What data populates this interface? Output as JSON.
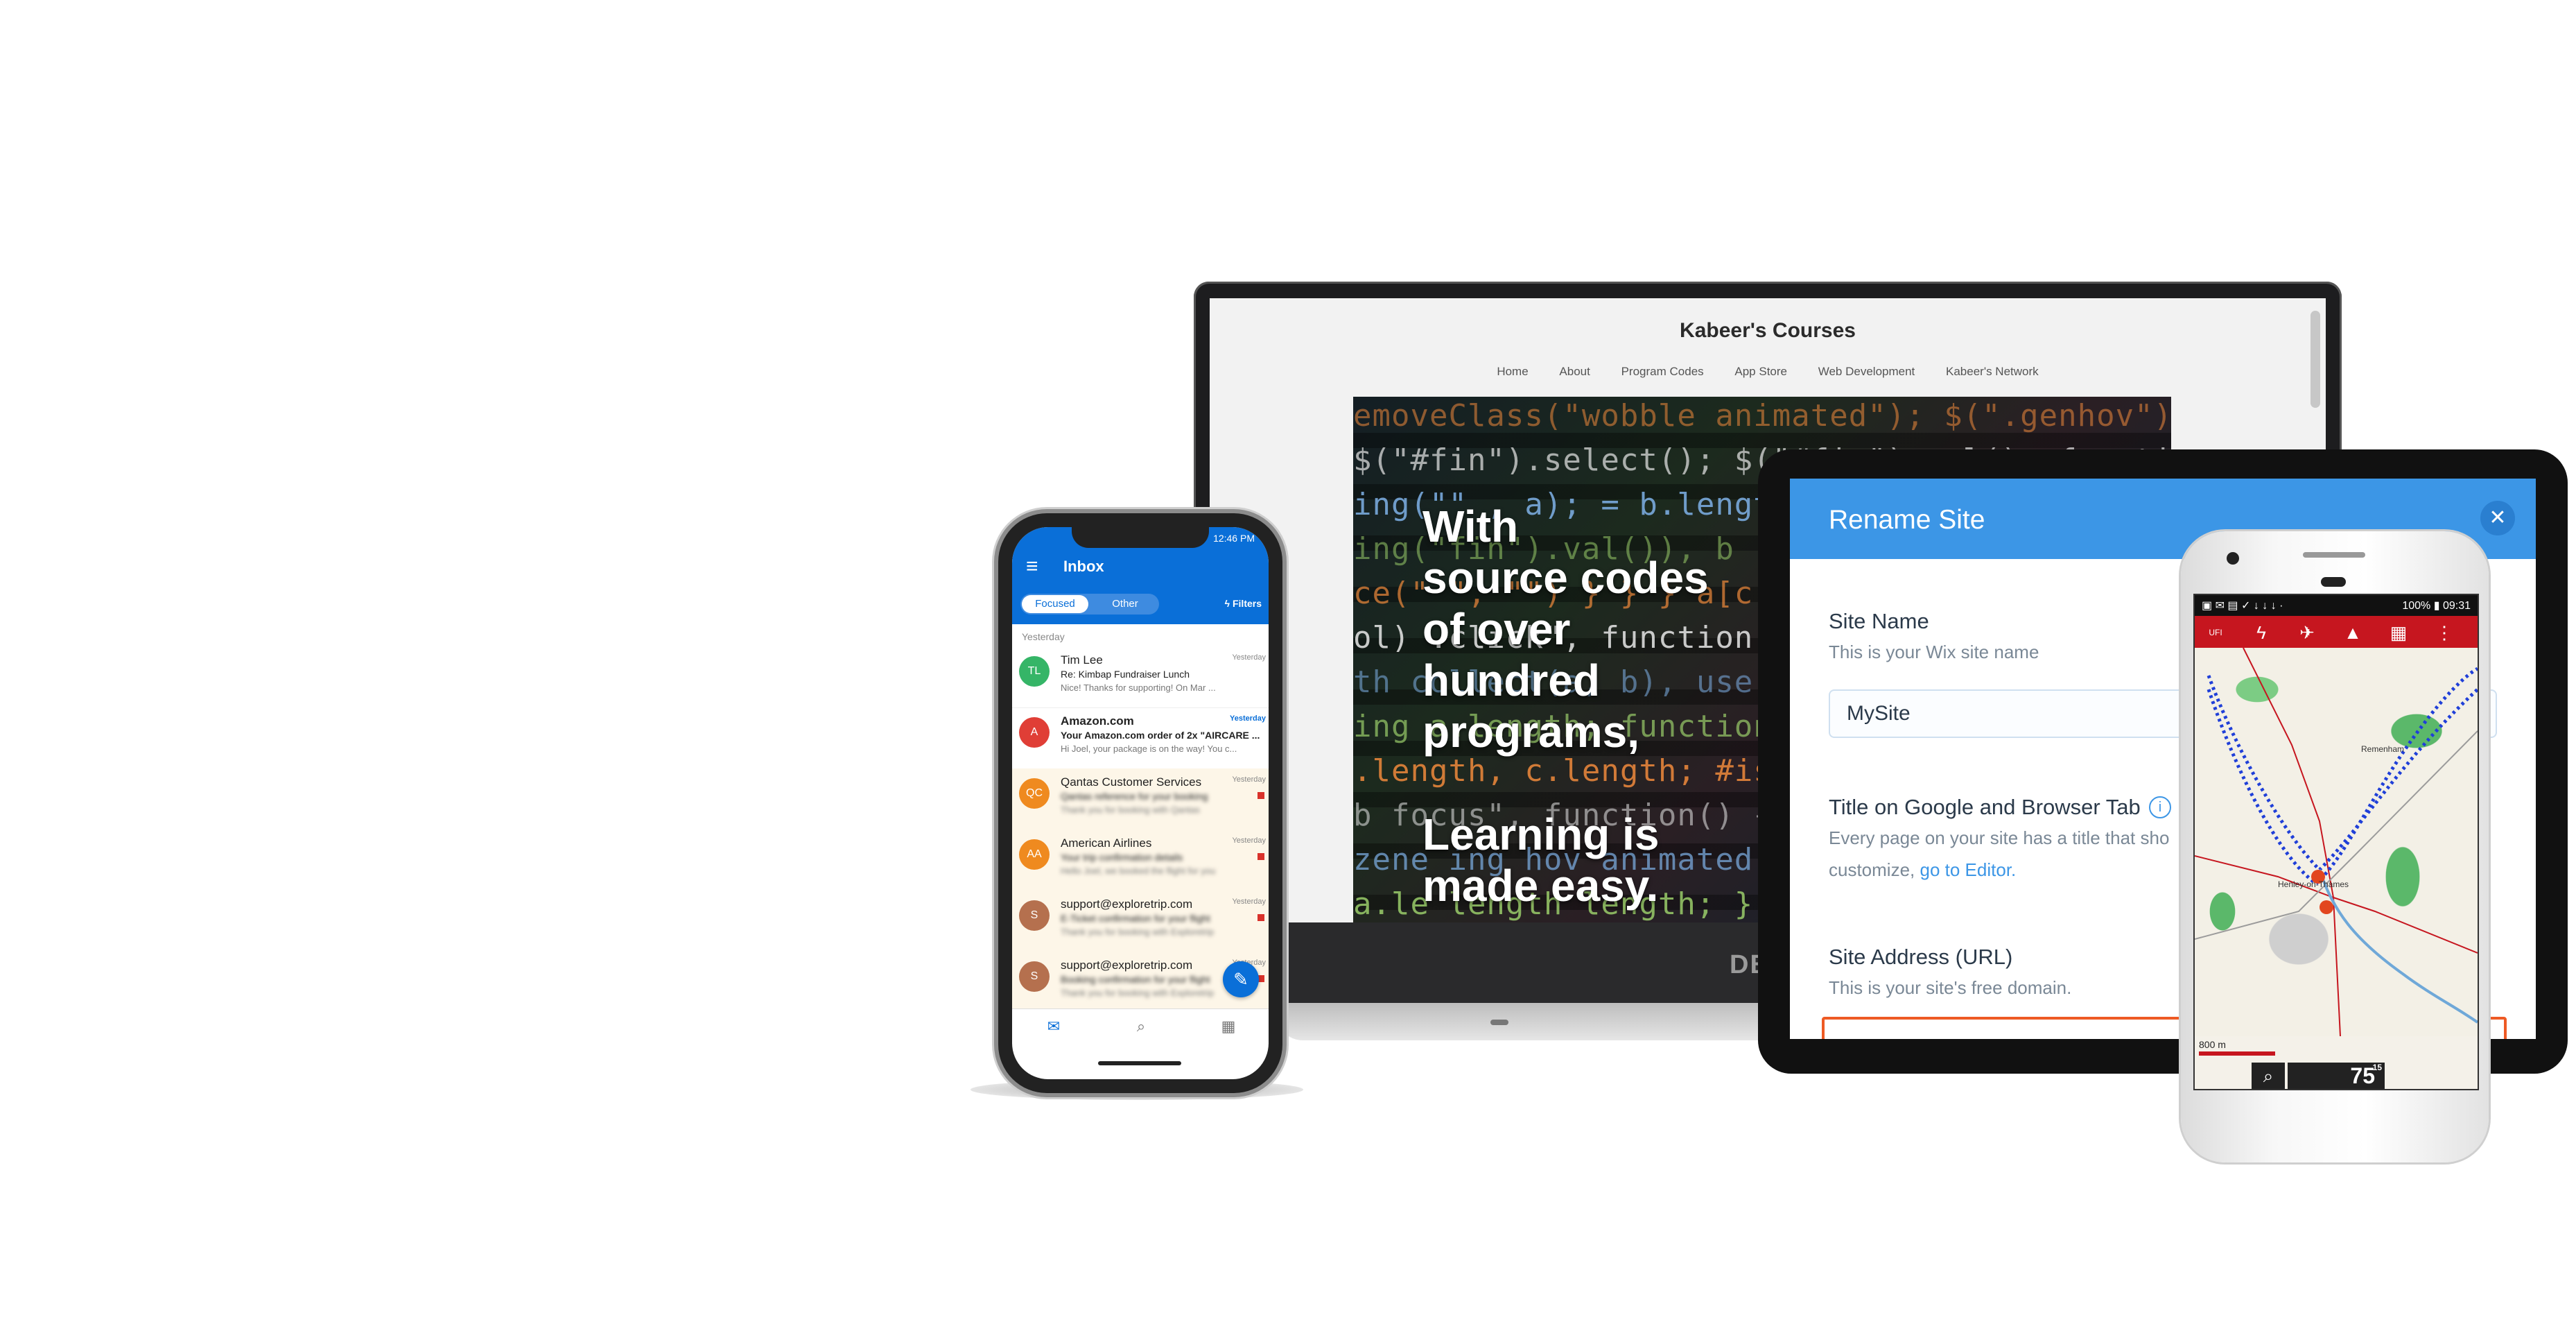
{
  "laptop": {
    "site_title": "Kabeer's Courses",
    "nav": [
      "Home",
      "About",
      "Program Codes",
      "App Store",
      "Web Development",
      "Kabeer's Network"
    ],
    "hero_lines": [
      "With",
      "source codes",
      "of over",
      "hundred",
      "programs,",
      "",
      "Learning is",
      "made easy."
    ],
    "code_lines": [
      "emoveClass(\"wobble animated\");  $(\".genhov\").removeClass",
      "$(\"#fin\").select();      $(\"#fin\").val(); function era",
      "ing(\"\"  , a);      = b.length; d = a.length",
      "ing(\"fin\").val()), b      ; c++) { if (a[c] ==",
      "ce(\"  \", \"\")        }  }  }  a[c] = a[c]",
      "ol)     .click\", function(a, b) {",
      "th  collect(a, b), use",
      "ing   a.length;  function(a,",
      "  .length, c.length;  #isp-st",
      "  b  focus\", function() {",
      "zene  ing  hov  animated\");",
      "a.le  length  length; }"
    ],
    "logo": "DELL",
    "colors": {
      "code_orange": "#f08a3c",
      "code_white": "#e8e8e8",
      "code_blue": "#7fb2e8",
      "code_green": "#9acd6a"
    }
  },
  "tablet": {
    "dialog_title": "Rename Site",
    "close_icon": "close-icon",
    "site_name_label": "Site Name",
    "site_name_help": "This is your Wix site name",
    "site_name_value": "MySite",
    "title_label": "Title on Google and Browser Tab",
    "title_help_1": "Every page on your site has a title that sho",
    "title_help_2_prefix": "customize,",
    "title_help_link": "go to Editor.",
    "url_label": "Site Address (URL)",
    "url_help": "This is your site's free domain.",
    "colors": {
      "header": "#3c96e6",
      "url_border": "#ee5a24"
    }
  },
  "android": {
    "status_left": "▣ ✉ ▤ ✓ ↓ ↓ ↓ ·",
    "status_right": "100% ▮ 09:31",
    "toolbar_icons": [
      "UFI",
      "ϟ",
      "✈",
      "▲",
      "▦",
      "⋮"
    ],
    "map_labels": [
      "Henley-on-Thames",
      "Remenham"
    ],
    "scale_label": "800 m",
    "speed": "75",
    "speed_sub": "15",
    "colors": {
      "toolbar": "#c6161f",
      "route": "#1f3fd8",
      "woods": "#5bb86a"
    }
  },
  "iphone": {
    "time": "12:46 PM",
    "title": "Inbox",
    "tab_focused": "Focused",
    "tab_other": "Other",
    "filters": "Filters",
    "section": "Yesterday",
    "emails": [
      {
        "initials": "TL",
        "color": "#35b567",
        "sender": "Tim Lee",
        "subject": "Re: Kimbap Fundraiser Lunch",
        "preview": "Nice! Thanks for supporting! On Mar ...",
        "date": "Yesterday",
        "unread": false,
        "blur": false,
        "flag": false
      },
      {
        "initials": "A",
        "color": "#e03e36",
        "sender": "Amazon.com",
        "subject": "Your Amazon.com order of 2x \"AIRCARE ...",
        "preview": "Hi Joel, your package is on the way! You c...",
        "date": "Yesterday",
        "unread": true,
        "blur": false,
        "flag": false
      },
      {
        "initials": "QC",
        "color": "#ef8a1f",
        "sender": "Qantas Customer Services",
        "subject": "Qantas reference for your booking",
        "preview": "Thank you for booking with Qantas",
        "date": "Yesterday",
        "unread": false,
        "blur": true,
        "flag": true
      },
      {
        "initials": "AA",
        "color": "#ef8a1f",
        "sender": "American Airlines",
        "subject": "Your trip confirmation details",
        "preview": "Hello Joel, we booked the flight for you",
        "date": "Yesterday",
        "unread": false,
        "blur": true,
        "flag": true
      },
      {
        "initials": "S",
        "color": "#b5704e",
        "sender": "support@exploretrip.com",
        "subject": "E-Ticket confirmation for your flight",
        "preview": "Thank you for booking with Exploretrip",
        "date": "Yesterday",
        "unread": false,
        "blur": true,
        "flag": true
      },
      {
        "initials": "S",
        "color": "#b5704e",
        "sender": "support@exploretrip.com",
        "subject": "Booking confirmation for your flight",
        "preview": "Thank you for booking with Exploretrip",
        "date": "Yesterday",
        "unread": false,
        "blur": true,
        "flag": true
      }
    ],
    "fab_icon": "pencil-icon",
    "tabbar_icons": [
      "✉",
      "⌕",
      "▦"
    ]
  }
}
